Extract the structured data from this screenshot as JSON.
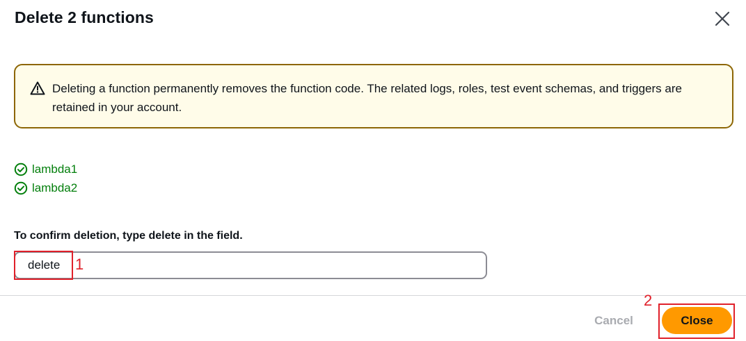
{
  "dialog": {
    "title": "Delete 2 functions",
    "close_icon": "close-icon"
  },
  "warning": {
    "icon": "warning-icon",
    "text": "Deleting a function permanently removes the function code. The related logs, roles, test event schemas, and triggers are retained in your account.",
    "bg_color": "#fffce9",
    "border_color": "#8d6605"
  },
  "functions": {
    "icon": "check-circle-icon",
    "color": "#037f0c",
    "items": [
      {
        "label": "lambda1"
      },
      {
        "label": "lambda2"
      }
    ]
  },
  "confirm": {
    "label_prefix": "To confirm deletion, type ",
    "label_keyword": "delete",
    "label_suffix": " in the field.",
    "input_value": "delete"
  },
  "footer": {
    "cancel_label": "Cancel",
    "close_label": "Close",
    "close_color": "#ff9900"
  },
  "annotations": [
    {
      "label": "1"
    },
    {
      "label": "2"
    }
  ]
}
